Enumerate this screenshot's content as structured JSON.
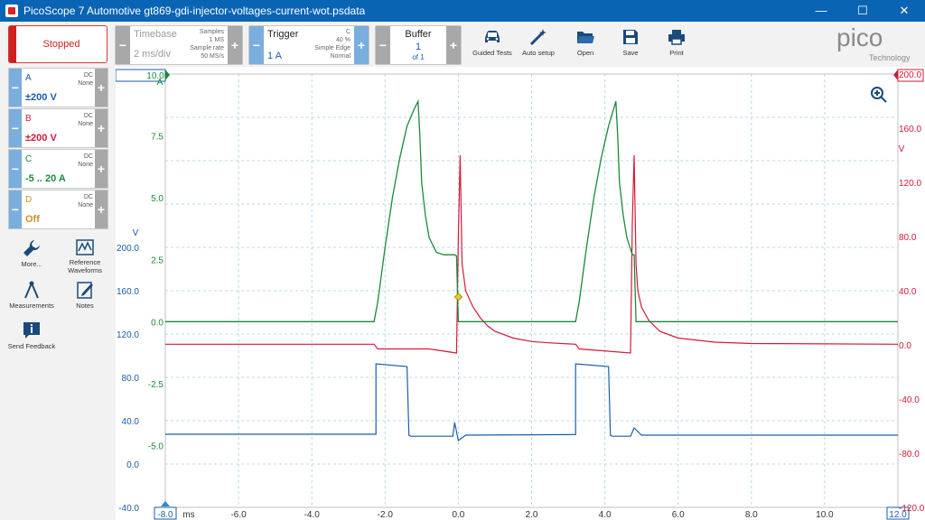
{
  "window": {
    "title": "PicoScope 7 Automotive gt869-gdi-injector-voltages-current-wot.psdata",
    "min_glyph": "—",
    "max_glyph": "☐",
    "close_glyph": "✕"
  },
  "toolbar": {
    "status_label": "Stopped",
    "timebase": {
      "label": "Timebase",
      "value": "2 ms/div",
      "samples_label": "Samples",
      "samples_value": "1 MS",
      "rate_label": "Sample rate",
      "rate_value": "50 MS/s"
    },
    "trigger": {
      "label": "Trigger",
      "value": "1 A",
      "channel": "C",
      "percent": "40 %",
      "type": "Simple Edge",
      "mode": "Normal"
    },
    "buffer": {
      "label": "Buffer",
      "value": "1",
      "of": "of 1"
    },
    "buttons": [
      "Guided Tests",
      "Auto setup",
      "Open",
      "Save",
      "Print"
    ],
    "logo_text": "pico",
    "logo_sub": "Technology",
    "minus": "−",
    "plus": "+"
  },
  "channels": [
    {
      "name": "A",
      "coupling": "DC",
      "filter": "None",
      "range": "±200 V",
      "color": "#1a5ea8"
    },
    {
      "name": "B",
      "coupling": "DC",
      "filter": "None",
      "range": "±200 V",
      "color": "#d21a3a"
    },
    {
      "name": "C",
      "coupling": "DC",
      "filter": "None",
      "range": "-5 .. 20 A",
      "color": "#1a8a3a"
    },
    {
      "name": "D",
      "coupling": "DC",
      "filter": "None",
      "range": "Off",
      "color": "#c8902a"
    }
  ],
  "sidebar_tools": [
    {
      "label": "More...",
      "icon": "wrench-icon"
    },
    {
      "label": "Reference Waveforms",
      "icon": "reference-waveforms-icon"
    },
    {
      "label": "Measurements",
      "icon": "compass-icon"
    },
    {
      "label": "Notes",
      "icon": "notes-icon"
    },
    {
      "label": "Send Feedback",
      "icon": "info-icon"
    }
  ],
  "scope": {
    "x_ticks": [
      "-6.0",
      "-4.0",
      "-2.0",
      "0.0",
      "2.0",
      "4.0",
      "6.0",
      "8.0",
      "10.0"
    ],
    "x_start": "-8.0",
    "x_end": "12.0",
    "x_unit": "ms",
    "c_unit": "A",
    "c_ticks": [
      "7.5",
      "5.0",
      "2.5",
      "0.0",
      "-2.5",
      "-5.0"
    ],
    "a_unit": "V",
    "a_ticks": [
      "200.0",
      "160.0",
      "120.0",
      "80.0",
      "40.0",
      "0.0",
      "-40.0"
    ],
    "b_unit": "V",
    "b_ticks": [
      "200.0",
      "160.0",
      "120.0",
      "80.0",
      "40.0",
      "0.0",
      "-40.0",
      "-80.0",
      "-120.0"
    ],
    "c_marker_label": "10.0",
    "colors": {
      "a": "#1a5ea8",
      "b": "#d21a3a",
      "c": "#1a8a3a",
      "grid": "#b8d8e8",
      "trigger": "#e8d020"
    }
  },
  "chart_data": {
    "type": "line",
    "x_unit": "ms",
    "xlim": [
      -8.0,
      12.0
    ],
    "series": [
      {
        "name": "C",
        "unit": "A",
        "ylim": [
          -7.5,
          10.0
        ],
        "x": [
          -8.0,
          -2.3,
          -2.2,
          -2.0,
          -1.8,
          -1.6,
          -1.4,
          -1.2,
          -1.1,
          -1.05,
          -1.0,
          -0.9,
          -0.8,
          -0.6,
          -0.4,
          -0.2,
          -0.1,
          -0.05,
          0.0,
          0.05,
          3.2,
          3.3,
          3.5,
          3.7,
          3.9,
          4.1,
          4.3,
          4.35,
          4.4,
          4.5,
          4.6,
          4.75,
          4.8,
          4.85,
          12.0
        ],
        "y": [
          0.0,
          0.0,
          0.8,
          3.0,
          5.0,
          6.6,
          7.9,
          8.6,
          8.9,
          7.5,
          5.6,
          4.3,
          3.4,
          2.8,
          2.7,
          2.7,
          2.7,
          2.65,
          0.0,
          0.0,
          0.0,
          0.8,
          3.0,
          5.0,
          6.6,
          7.9,
          8.9,
          7.5,
          5.6,
          4.3,
          3.4,
          2.7,
          2.7,
          0.0,
          0.0
        ]
      },
      {
        "name": "A",
        "unit": "V",
        "ylim": [
          -40.0,
          200.0
        ],
        "x": [
          -8.0,
          -2.25,
          -2.25,
          -1.4,
          -1.35,
          -1.3,
          -0.15,
          -0.1,
          0.0,
          0.2,
          3.2,
          3.2,
          4.1,
          4.15,
          4.2,
          4.7,
          4.8,
          5.0,
          12.0
        ],
        "y": [
          0.5,
          0.5,
          39.5,
          38.0,
          0.0,
          -0.6,
          -0.6,
          7.0,
          -3.0,
          0.0,
          0.3,
          39.5,
          38.0,
          0.0,
          -0.6,
          -0.6,
          4.0,
          0.0,
          0.0
        ]
      },
      {
        "name": "B",
        "unit": "V",
        "ylim": [
          -120.0,
          200.0
        ],
        "x": [
          -8.0,
          -2.3,
          -2.2,
          -0.8,
          -0.05,
          0.0,
          0.05,
          0.1,
          0.2,
          0.4,
          0.6,
          0.8,
          1.0,
          1.5,
          2.0,
          2.5,
          3.2,
          3.3,
          4.7,
          4.75,
          4.8,
          4.85,
          4.9,
          5.0,
          5.2,
          5.5,
          6.0,
          7.0,
          8.0,
          12.0
        ],
        "y": [
          0.5,
          0.5,
          -3.0,
          -3.0,
          -6.0,
          80.0,
          140.0,
          60.0,
          40.0,
          28.0,
          20.0,
          14.0,
          10.0,
          5.0,
          2.5,
          1.5,
          0.5,
          -3.0,
          -6.0,
          90.0,
          140.0,
          60.0,
          40.0,
          28.0,
          18.0,
          10.0,
          5.0,
          2.0,
          1.0,
          0.5
        ]
      }
    ]
  }
}
